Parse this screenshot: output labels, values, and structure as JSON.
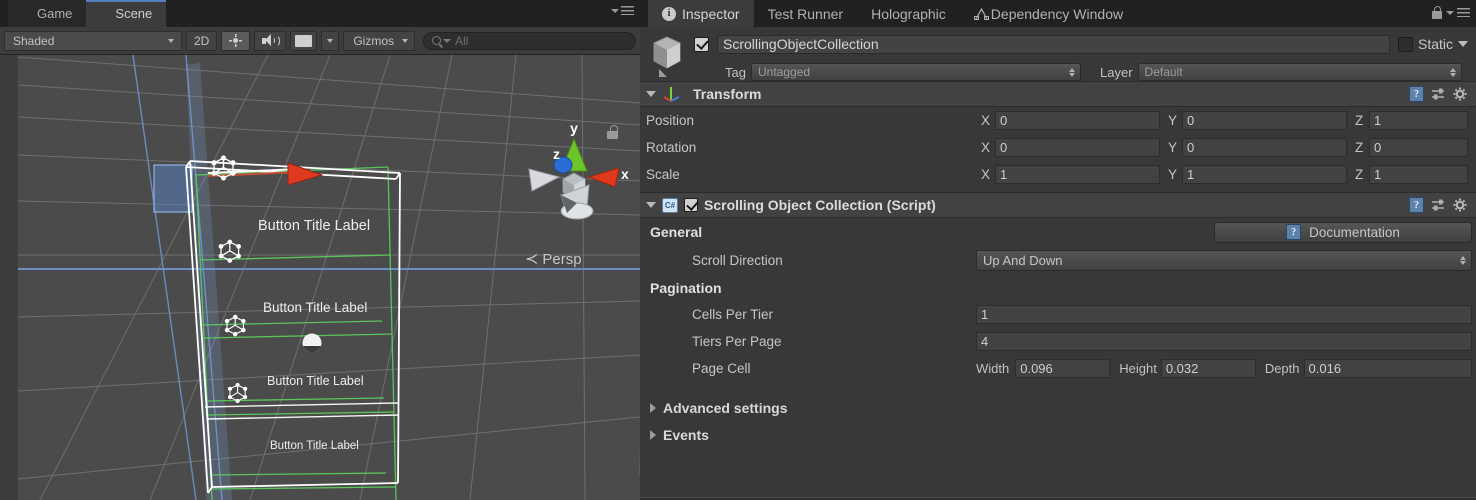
{
  "scene_panel": {
    "tabs": [
      {
        "label": "Game",
        "icon": "moon-icon",
        "active": false
      },
      {
        "label": "Scene",
        "icon": "grid-icon",
        "active": true
      }
    ],
    "toolbar": {
      "shading_mode": "Shaded",
      "mode_2d": "2D",
      "lighting_icon": "sun-icon",
      "audio_icon": "speaker-icon",
      "fx_icon": "image-effects-icon",
      "gizmos_label": "Gizmos",
      "search_placeholder": "All",
      "search_value": ""
    },
    "viewport": {
      "gizmo_axes": {
        "x": "x",
        "y": "y",
        "z": "z"
      },
      "camera_mode": "Persp",
      "lock_icon": "unlocked-icon",
      "object_labels": [
        "Button Title Label",
        "Button Title Label",
        "Button Title Label",
        "Button Title Label"
      ],
      "colors": {
        "background": "#4b4b4b",
        "grid_line": "#9a9a9a",
        "horizon": "#6b8fc4",
        "selection_outline": "#ffffff",
        "collider_green": "#5cd15c",
        "axis_x": "#d8432a",
        "axis_y": "#6cc52a",
        "axis_z": "#2a6cd8"
      }
    }
  },
  "inspector": {
    "tabs": [
      {
        "label": "Inspector",
        "icon": "info-icon",
        "active": true
      },
      {
        "label": "Test Runner",
        "icon": "",
        "active": false
      },
      {
        "label": "Holographic",
        "icon": "",
        "active": false
      },
      {
        "label": "Dependency Window",
        "icon": "dependency-icon",
        "active": false
      }
    ],
    "tabbar_right": {
      "lock_icon": "lock-icon",
      "menu_icon": "menu-icon"
    },
    "object": {
      "enabled": true,
      "name": "ScrollingObjectCollection",
      "static_label": "Static",
      "static_checked": false,
      "tag_label": "Tag",
      "tag_value": "Untagged",
      "layer_label": "Layer",
      "layer_value": "Default"
    },
    "transform": {
      "title": "Transform",
      "expanded": true,
      "rows": [
        {
          "label": "Position",
          "x": "0",
          "y": "0",
          "z": "1"
        },
        {
          "label": "Rotation",
          "x": "0",
          "y": "0",
          "z": "0"
        },
        {
          "label": "Scale",
          "x": "1",
          "y": "1",
          "z": "1"
        }
      ],
      "axis_labels": {
        "x": "X",
        "y": "Y",
        "z": "Z"
      },
      "icons": {
        "help": "help-icon",
        "preset": "preset-icon",
        "settings": "gear-icon"
      }
    },
    "script_component": {
      "title": "Scrolling Object Collection (Script)",
      "enabled": true,
      "expanded": true,
      "icons": {
        "help": "help-icon",
        "preset": "preset-icon",
        "settings": "gear-icon"
      },
      "general": {
        "header": "General",
        "documentation_button": "Documentation",
        "scroll_direction": {
          "label": "Scroll Direction",
          "value": "Up And Down"
        }
      },
      "pagination": {
        "header": "Pagination",
        "cells_per_tier": {
          "label": "Cells Per Tier",
          "value": "1"
        },
        "tiers_per_page": {
          "label": "Tiers Per Page",
          "value": "4"
        },
        "page_cell": {
          "label": "Page Cell",
          "width_label": "Width",
          "width_value": "0.096",
          "height_label": "Height",
          "height_value": "0.032",
          "depth_label": "Depth",
          "depth_value": "0.016"
        }
      },
      "foldouts": [
        {
          "label": "Advanced settings",
          "expanded": false
        },
        {
          "label": "Events",
          "expanded": false
        }
      ]
    }
  },
  "theme": {
    "window_bg": "#383838",
    "tabbar_bg": "#212121",
    "panel_bg": "#3c3c3c",
    "field_bg": "#424242",
    "accent_blue": "#4f7fbf",
    "text": "#c6c6c6"
  }
}
